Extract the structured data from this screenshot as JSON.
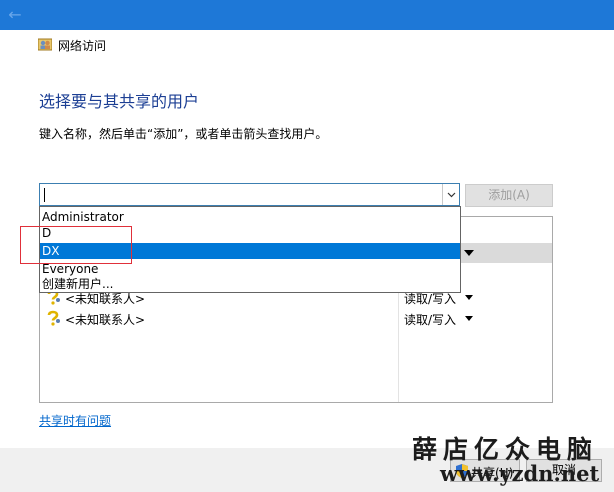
{
  "window": {
    "title": "网络访问"
  },
  "heading": "选择要与其共享的用户",
  "instruction": "键入名称，然后单击“添加”，或者单击箭头查找用户。",
  "name_input": {
    "value": ""
  },
  "add_button": "添加(A)",
  "dropdown": {
    "items": [
      "Administrator",
      "D",
      "DX",
      "Everyone",
      "创建新用户..."
    ],
    "selected": "DX"
  },
  "share_table": {
    "rows": [
      {
        "name": "<未知联系人>",
        "permission": "读取/写入"
      },
      {
        "name": "<未知联系人>",
        "permission": "读取/写入"
      }
    ]
  },
  "help_link": "共享时有问题",
  "footer": {
    "share_button": "共享(H)",
    "cancel_button": "取消"
  },
  "watermark": {
    "line1": "薛店亿众电脑",
    "line2": "www.yzdn.net"
  },
  "colors": {
    "titlebar": "#1e78d7",
    "heading": "#1c3f94",
    "selection": "#0078d7",
    "link": "#0066cc",
    "highlight_box": "#e0303a"
  }
}
